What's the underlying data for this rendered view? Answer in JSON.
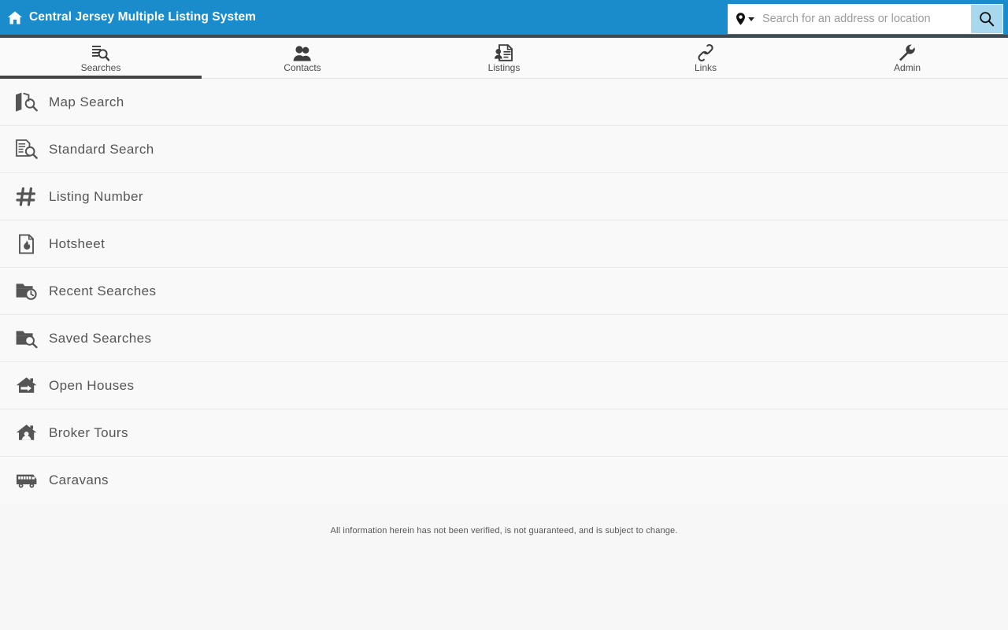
{
  "header": {
    "home_icon": "home-icon",
    "title": "Central Jersey Multiple Listing System",
    "background_color": "#1a8ccc",
    "border_color": "#3a4a52"
  },
  "search": {
    "type_icon": "location-pin-icon",
    "dropdown_icon": "chevron-down-icon",
    "placeholder": "Search for an address or location",
    "value": "",
    "button_icon": "search-icon",
    "button_color": "#a8d8ee"
  },
  "tabs": [
    {
      "label": "Searches",
      "icon": "document-search-icon",
      "active": true
    },
    {
      "label": "Contacts",
      "icon": "people-icon",
      "active": false
    },
    {
      "label": "Listings",
      "icon": "listing-document-icon",
      "active": false
    },
    {
      "label": "Links",
      "icon": "chain-link-icon",
      "active": false
    },
    {
      "label": "Admin",
      "icon": "wrench-icon",
      "active": false
    }
  ],
  "menu": {
    "items": [
      {
        "label": "Map Search",
        "icon": "map-search-icon"
      },
      {
        "label": "Standard Search",
        "icon": "document-search-icon"
      },
      {
        "label": "Listing Number",
        "icon": "hash-icon"
      },
      {
        "label": "Hotsheet",
        "icon": "flame-document-icon"
      },
      {
        "label": "Recent Searches",
        "icon": "folder-clock-icon"
      },
      {
        "label": "Saved Searches",
        "icon": "folder-search-icon"
      },
      {
        "label": "Open Houses",
        "icon": "house-arrow-icon"
      },
      {
        "label": "Broker Tours",
        "icon": "house-person-icon"
      },
      {
        "label": "Caravans",
        "icon": "bus-icon"
      }
    ]
  },
  "footer": {
    "disclaimer": "All information herein has not been verified, is not guaranteed, and is subject to change."
  }
}
